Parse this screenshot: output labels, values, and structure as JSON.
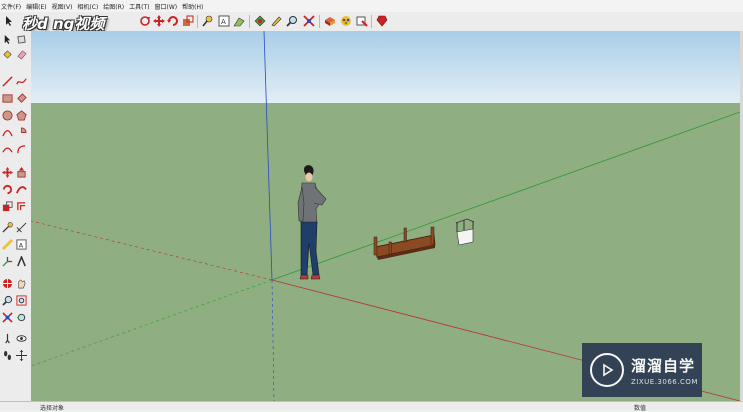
{
  "menu": {
    "items": [
      "文件(F)",
      "编辑(E)",
      "视图(V)",
      "相机(C)",
      "绘图(R)",
      "工具(T)",
      "窗口(W)",
      "帮助(H)"
    ]
  },
  "branding": {
    "logo_text": "秒d ng视频",
    "watermark_title": "溜溜自学",
    "watermark_url": "ZIXUE.3066.COM"
  },
  "toolbar": {
    "icons": [
      "orbit-icon",
      "move-icon",
      "rotate-icon",
      "scale-icon",
      "walk-icon",
      "text-icon",
      "tape-icon",
      "push-pull-icon",
      "follow-me-icon",
      "zoom-icon",
      "zoom-extents-icon",
      "components-icon",
      "materials-icon",
      "styles-icon",
      "ruby-icon"
    ]
  },
  "left_toolbar": {
    "icons": [
      "select-icon",
      "make-component-icon",
      "paint-bucket-icon",
      "eraser-icon",
      "line-icon",
      "freehand-icon",
      "rectangle-icon",
      "rotated-rectangle-icon",
      "circle-icon",
      "polygon-icon",
      "arc-icon",
      "pie-icon",
      "two-point-arc-icon",
      "three-point-arc-icon",
      "move-icon",
      "push-pull-icon",
      "rotate-icon",
      "follow-me-icon",
      "scale-icon",
      "offset-icon",
      "tape-measure-icon",
      "dimension-icon",
      "protractor-icon",
      "text-icon",
      "axes-icon",
      "3d-text-icon",
      "section-plane-icon",
      "orbit-icon",
      "pan-icon",
      "zoom-icon",
      "zoom-window-icon",
      "zoom-extents-icon",
      "previous-view-icon",
      "walk-icon",
      "look-around-icon",
      "position-camera-icon",
      "footprints-icon"
    ]
  },
  "status": {
    "text": "选择对象",
    "measurements_label": "数值"
  },
  "colors": {
    "sky": "#c5dff0",
    "ground": "#8fae82",
    "red_axis": "#b5322d",
    "green_axis": "#2e9a2e",
    "blue_axis": "#2b4bc2",
    "watermark_bg": "#2c3a52"
  }
}
